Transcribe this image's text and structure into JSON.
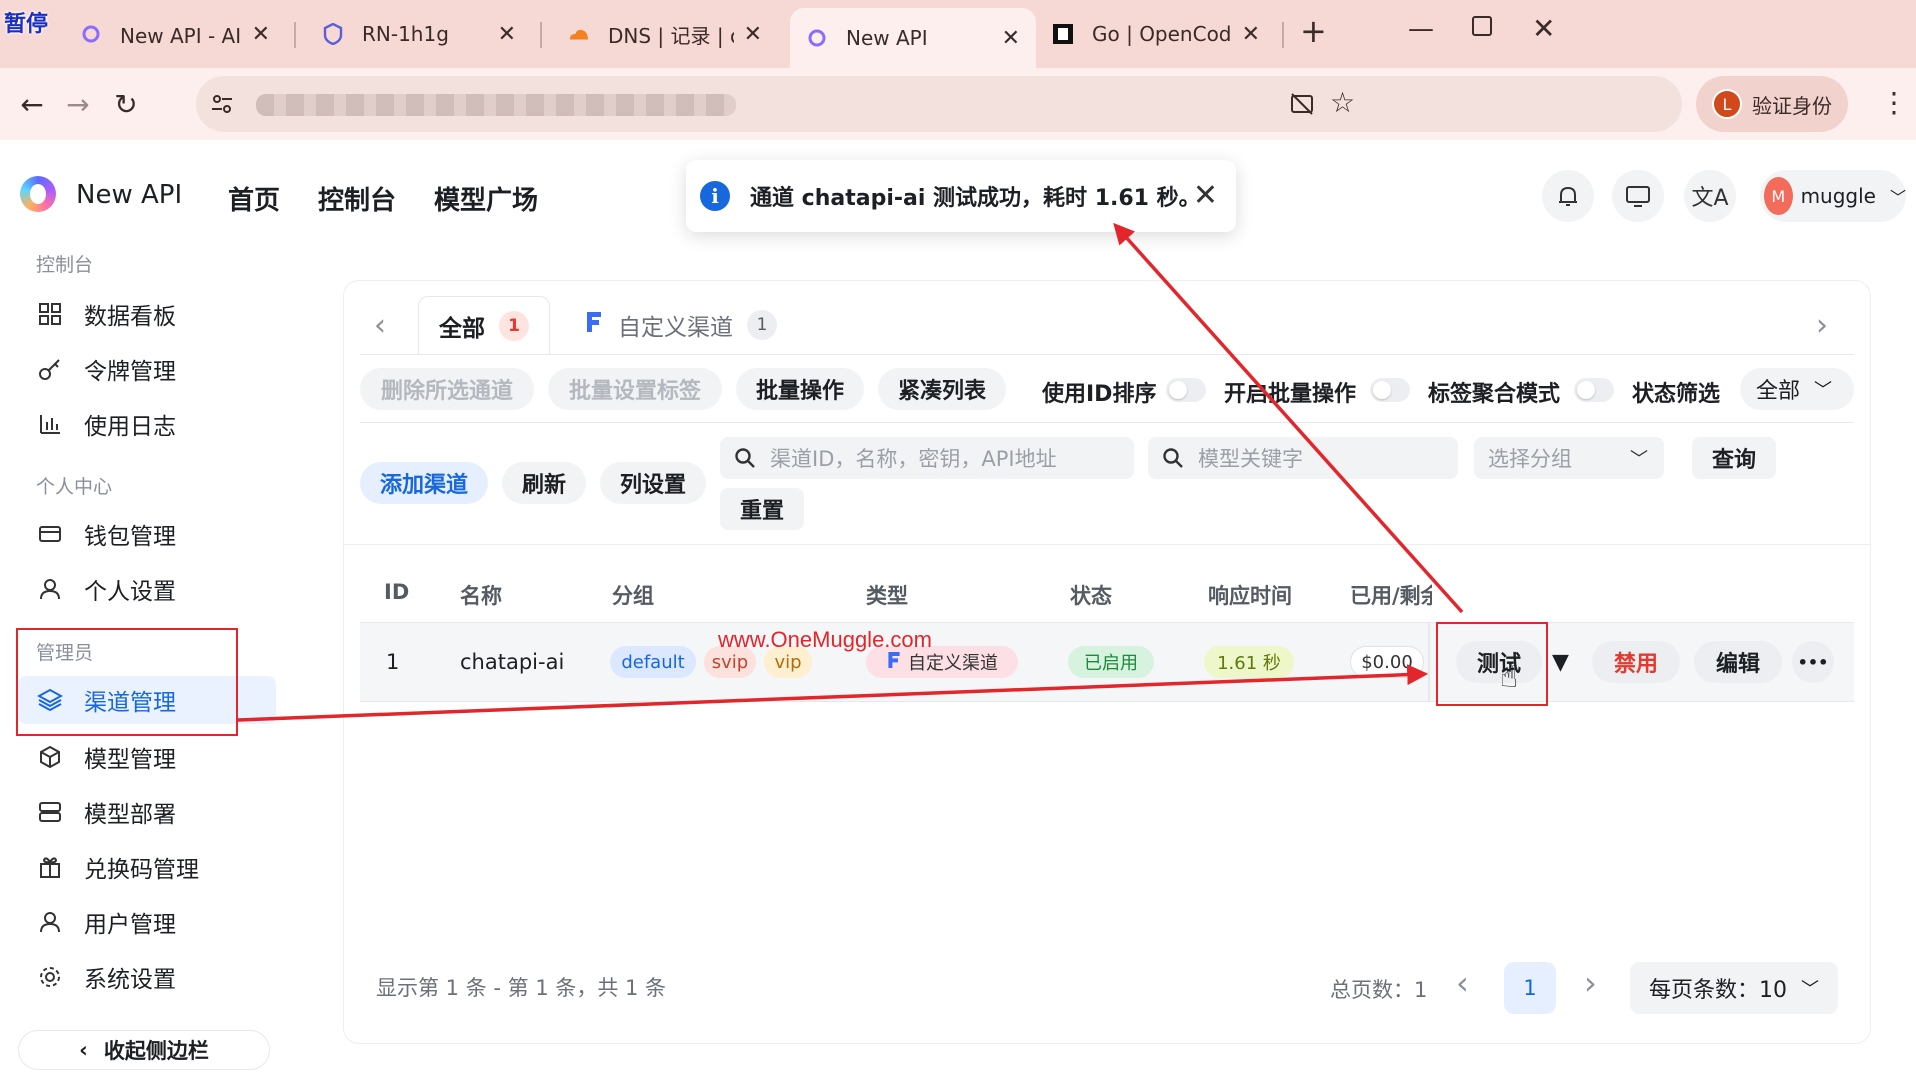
{
  "browser": {
    "paused_badge": "暂停",
    "tabs": [
      {
        "label": "New API - AI 基座",
        "icon": "newapi-favicon-icon"
      },
      {
        "label": "RN-1h1g",
        "icon": "shield-favicon-icon"
      },
      {
        "label": "DNS | 记录 | onemuc",
        "icon": "cloudflare-favicon-icon"
      },
      {
        "label": "New API",
        "icon": "newapi-favicon-icon",
        "active": true
      },
      {
        "label": "Go | OpenCode",
        "icon": "opencode-favicon-icon"
      }
    ],
    "new_tab": "+",
    "verify_label": "验证身份",
    "verify_avatar": "L"
  },
  "app": {
    "brand": "New API",
    "nav": [
      "首页",
      "控制台",
      "模型广场"
    ],
    "user": {
      "initial": "M",
      "name": "muggle"
    }
  },
  "toast": {
    "message": "通道 chatapi-ai 测试成功，耗时 1.61 秒。",
    "close": "✕"
  },
  "sidebar": {
    "section_console": "控制台",
    "console_items": [
      {
        "label": "数据看板",
        "icon": "dashboard-grid-icon"
      },
      {
        "label": "令牌管理",
        "icon": "key-icon"
      },
      {
        "label": "使用日志",
        "icon": "bar-chart-icon"
      }
    ],
    "section_personal": "个人中心",
    "personal_items": [
      {
        "label": "钱包管理",
        "icon": "wallet-icon"
      },
      {
        "label": "个人设置",
        "icon": "user-icon"
      }
    ],
    "section_admin": "管理员",
    "admin_items": [
      {
        "label": "渠道管理",
        "icon": "layers-icon",
        "active": true
      },
      {
        "label": "模型管理",
        "icon": "cube-icon"
      },
      {
        "label": "模型部署",
        "icon": "server-icon"
      },
      {
        "label": "兑换码管理",
        "icon": "gift-icon"
      },
      {
        "label": "用户管理",
        "icon": "user-icon"
      },
      {
        "label": "系统设置",
        "icon": "gear-icon"
      }
    ],
    "collapse_label": "收起侧边栏"
  },
  "channels": {
    "tabs": [
      {
        "label": "全部",
        "count": "1"
      },
      {
        "label": "自定义渠道",
        "count": "1"
      }
    ],
    "toolbar": {
      "delete_selected": "删除所选通道",
      "batch_tag": "批量设置标签",
      "batch_ops": "批量操作",
      "compact_list": "紧凑列表",
      "sort_by_id": "使用ID排序",
      "enable_batch": "开启批量操作",
      "tag_aggregate": "标签聚合模式",
      "status_filter": "状态筛选",
      "status_value": "全部"
    },
    "actions": {
      "add": "添加渠道",
      "refresh": "刷新",
      "columns": "列设置",
      "reset": "重置",
      "query": "查询"
    },
    "search": {
      "channel_placeholder": "渠道ID，名称，密钥，API地址",
      "model_placeholder": "模型关键字",
      "group_placeholder": "选择分组"
    },
    "table": {
      "columns": [
        "ID",
        "名称",
        "分组",
        "类型",
        "状态",
        "响应时间",
        "已用/剩余"
      ],
      "rows": [
        {
          "id": "1",
          "name": "chatapi-ai",
          "groups": [
            "default",
            "svip",
            "vip"
          ],
          "type": "自定义渠道",
          "status": "已启用",
          "response_time": "1.61 秒",
          "balance": "$0.00",
          "test_label": "测试",
          "disable_label": "禁用",
          "edit_label": "编辑",
          "more_label": "•••"
        }
      ]
    },
    "pagination": {
      "summary": "显示第 1 条 - 第 1 条，共 1 条",
      "total_pages": "总页数：1",
      "current_page": "1",
      "page_size": "每页条数：10"
    }
  },
  "annotations": {
    "watermark": "www.OneMuggle.com",
    "arrow_color": "#e3262b"
  },
  "colors": {
    "accent": "#1668dc",
    "danger": "#e23a2f",
    "tab_bar": "#f6d8d4"
  }
}
